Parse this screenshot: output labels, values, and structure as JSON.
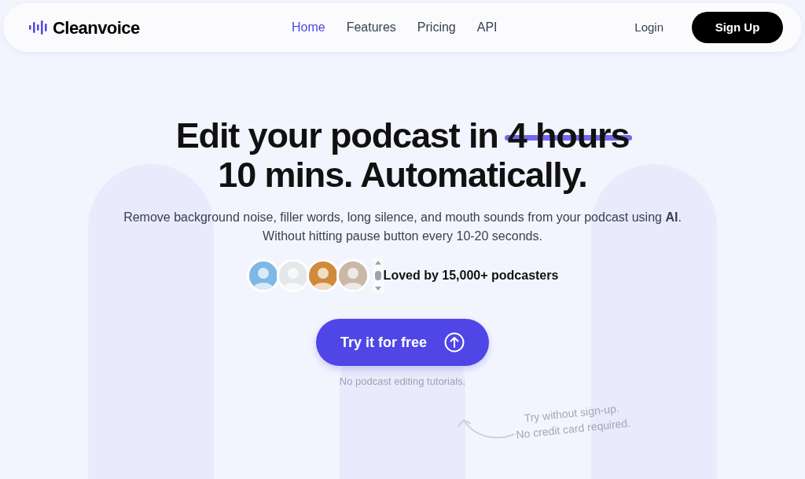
{
  "header": {
    "logo": "Cleanvoice",
    "nav": [
      {
        "label": "Home",
        "selected": true
      },
      {
        "label": "Features",
        "selected": false
      },
      {
        "label": "Pricing",
        "selected": false
      },
      {
        "label": "API",
        "selected": false
      }
    ],
    "login": "Login",
    "signup": "Sign Up"
  },
  "hero": {
    "headline_start": "Edit your podcast in",
    "headline_struck": "4 hours",
    "headline_line2": "10 mins. Automatically.",
    "subtitle_line1": "Remove background noise, filler words, long silence, and mouth sounds from your podcast using **AI**.",
    "subtitle_line2": "Without hitting pause button every 10-20 seconds.",
    "social_proof": "Loved by 15,000+ podcasters",
    "cta": "Try it for free",
    "cta_note": "No podcast editing tutorials.",
    "side_note_line1": "Try without sign-up.",
    "side_note_line2": "No credit card required."
  }
}
